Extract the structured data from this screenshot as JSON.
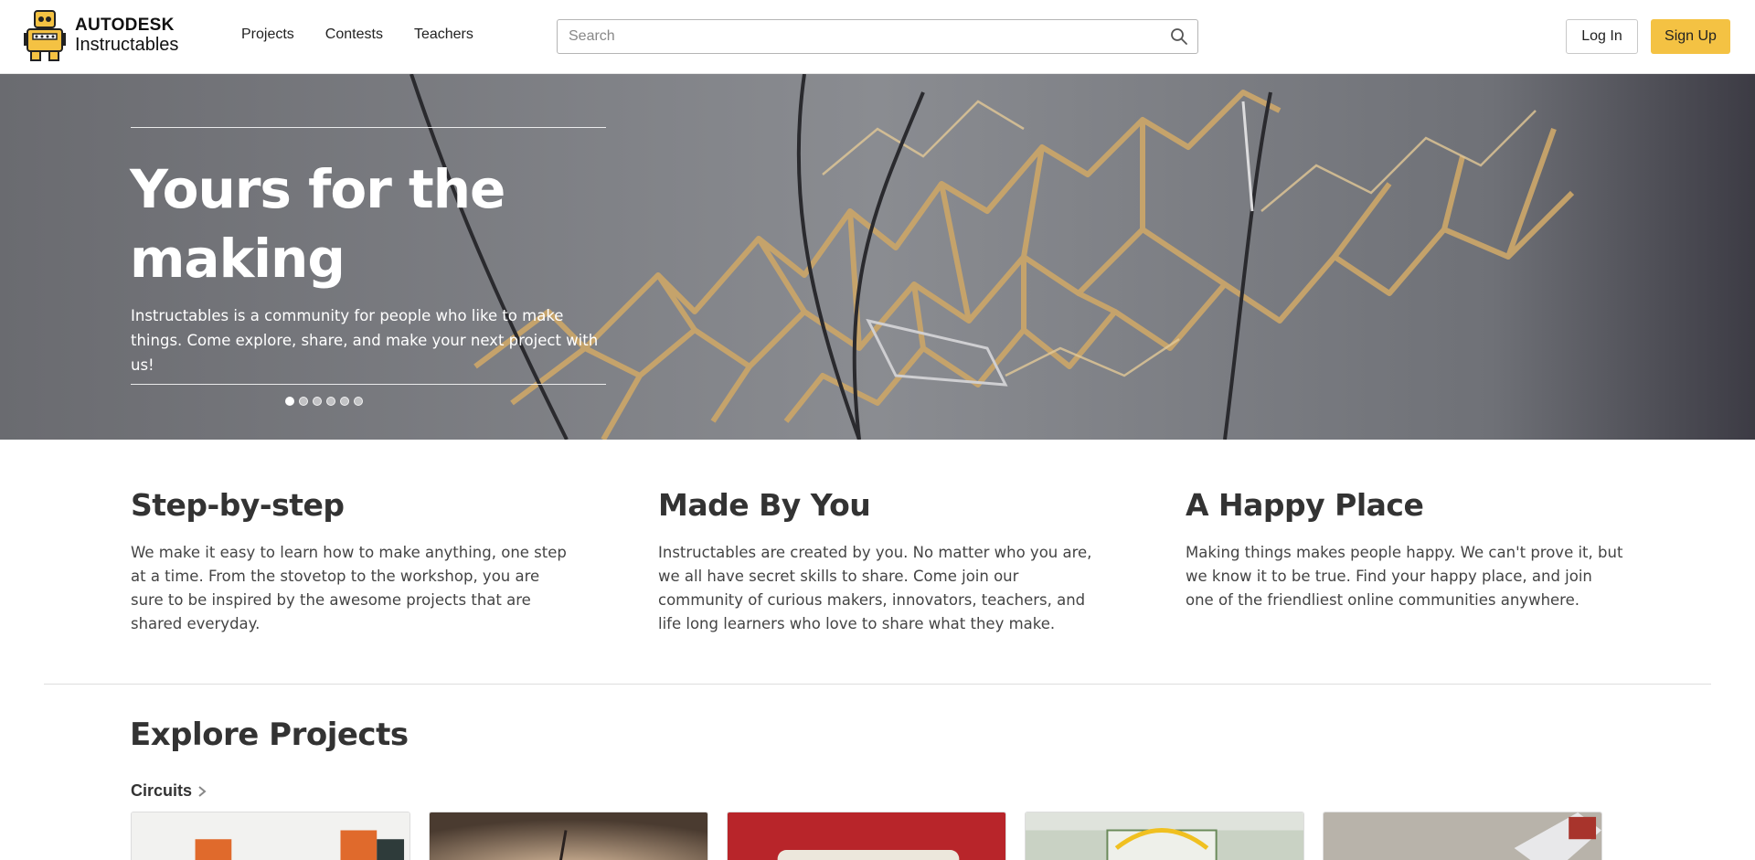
{
  "header": {
    "logo": {
      "brand": "AUTODESK",
      "name": "Instructables"
    },
    "nav": [
      {
        "label": "Projects"
      },
      {
        "label": "Contests"
      },
      {
        "label": "Teachers"
      }
    ],
    "search": {
      "placeholder": "Search",
      "value": ""
    },
    "login_label": "Log In",
    "signup_label": "Sign Up",
    "colors": {
      "signup_bg": "#f4c243"
    }
  },
  "hero": {
    "title": "Yours for the making",
    "subtitle": "Instructables is a community for people who like to make things. Come explore, share, and make your next project with us!",
    "slides": 6,
    "active_slide": 1
  },
  "features": [
    {
      "title": "Step-by-step",
      "text": "We make it easy to learn how to make anything, one step at a time. From the stovetop to the workshop, you are sure to be inspired by the awesome projects that are shared everyday."
    },
    {
      "title": "Made By You",
      "text": "Instructables are created by you. No matter who you are, we all have secret skills to share. Come join our community of curious makers, innovators, teachers, and life long learners who love to share what they make."
    },
    {
      "title": "A Happy Place",
      "text": "Making things makes people happy. We can't prove it, but we know it to be true. Find your happy place, and join one of the friendliest online communities anywhere."
    }
  ],
  "explore": {
    "title": "Explore Projects",
    "category": "Circuits"
  }
}
